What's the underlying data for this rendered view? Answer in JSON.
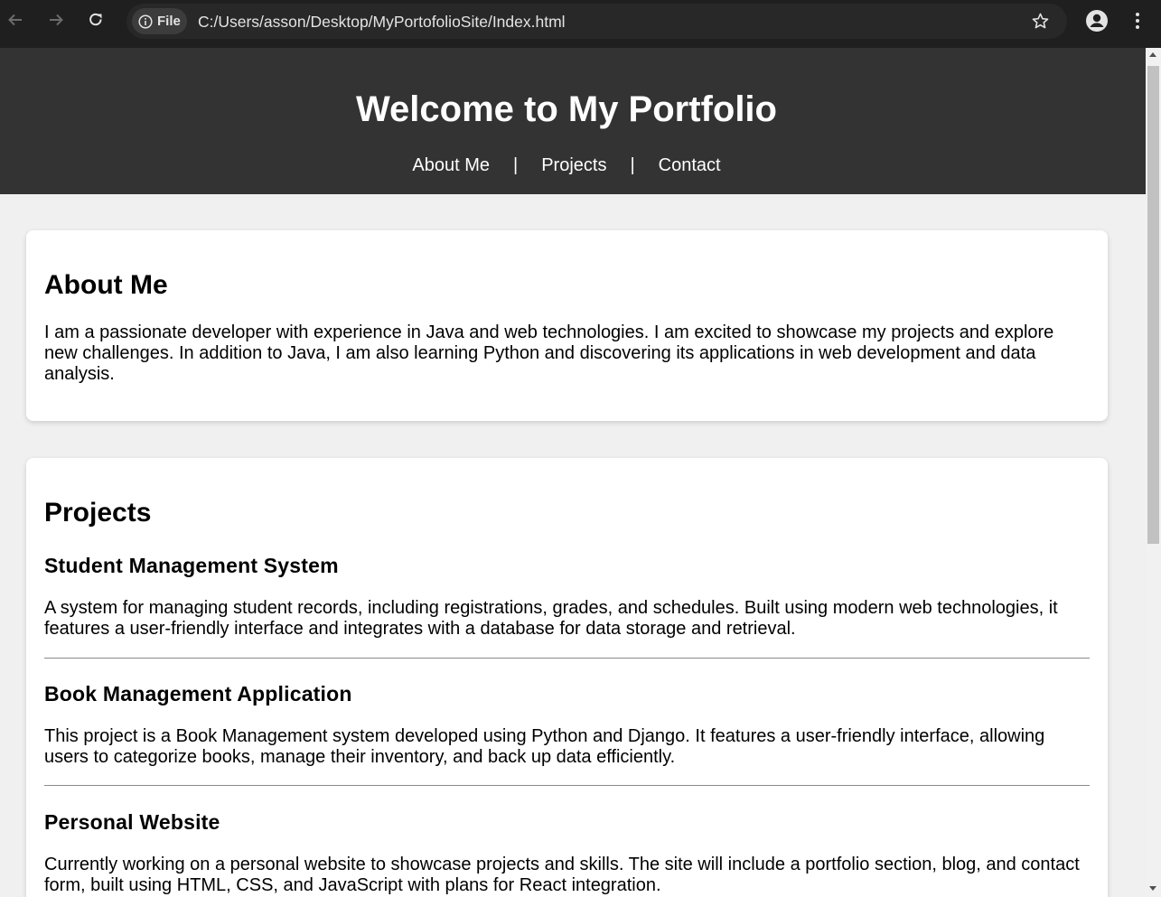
{
  "browser": {
    "site_chip_label": "File",
    "url": "C:/Users/asson/Desktop/MyPortofolioSite/Index.html",
    "icons": [
      "back-arrow-icon",
      "forward-arrow-icon",
      "reload-icon",
      "info-icon",
      "star-icon",
      "profile-icon",
      "kebab-menu-icon"
    ]
  },
  "header": {
    "title": "Welcome to My Portfolio",
    "nav": [
      {
        "label": "About Me"
      },
      {
        "label": "Projects"
      },
      {
        "label": "Contact"
      }
    ],
    "separator": "|"
  },
  "about": {
    "heading": "About Me",
    "text": "I am a passionate developer with experience in Java and web technologies. I am excited to showcase my projects and explore new challenges. In addition to Java, I am also learning Python and discovering its applications in web development and data analysis."
  },
  "projects": {
    "heading": "Projects",
    "items": [
      {
        "title": "Student Management System",
        "description": "A system for managing student records, including registrations, grades, and schedules. Built using modern web technologies, it features a user-friendly interface and integrates with a database for data storage and retrieval."
      },
      {
        "title": "Book Management Application",
        "description": "This project is a Book Management system developed using Python and Django. It features a user-friendly interface, allowing users to categorize books, manage their inventory, and back up data efficiently."
      },
      {
        "title": "Personal Website",
        "description": "Currently working on a personal website to showcase projects and skills. The site will include a portfolio section, blog, and contact form, built using HTML, CSS, and JavaScript with plans for React integration."
      }
    ]
  },
  "colors": {
    "header_bg": "#333333",
    "page_bg": "#f0f0f0",
    "card_bg": "#ffffff",
    "browser_bg": "#1f1f1f"
  }
}
